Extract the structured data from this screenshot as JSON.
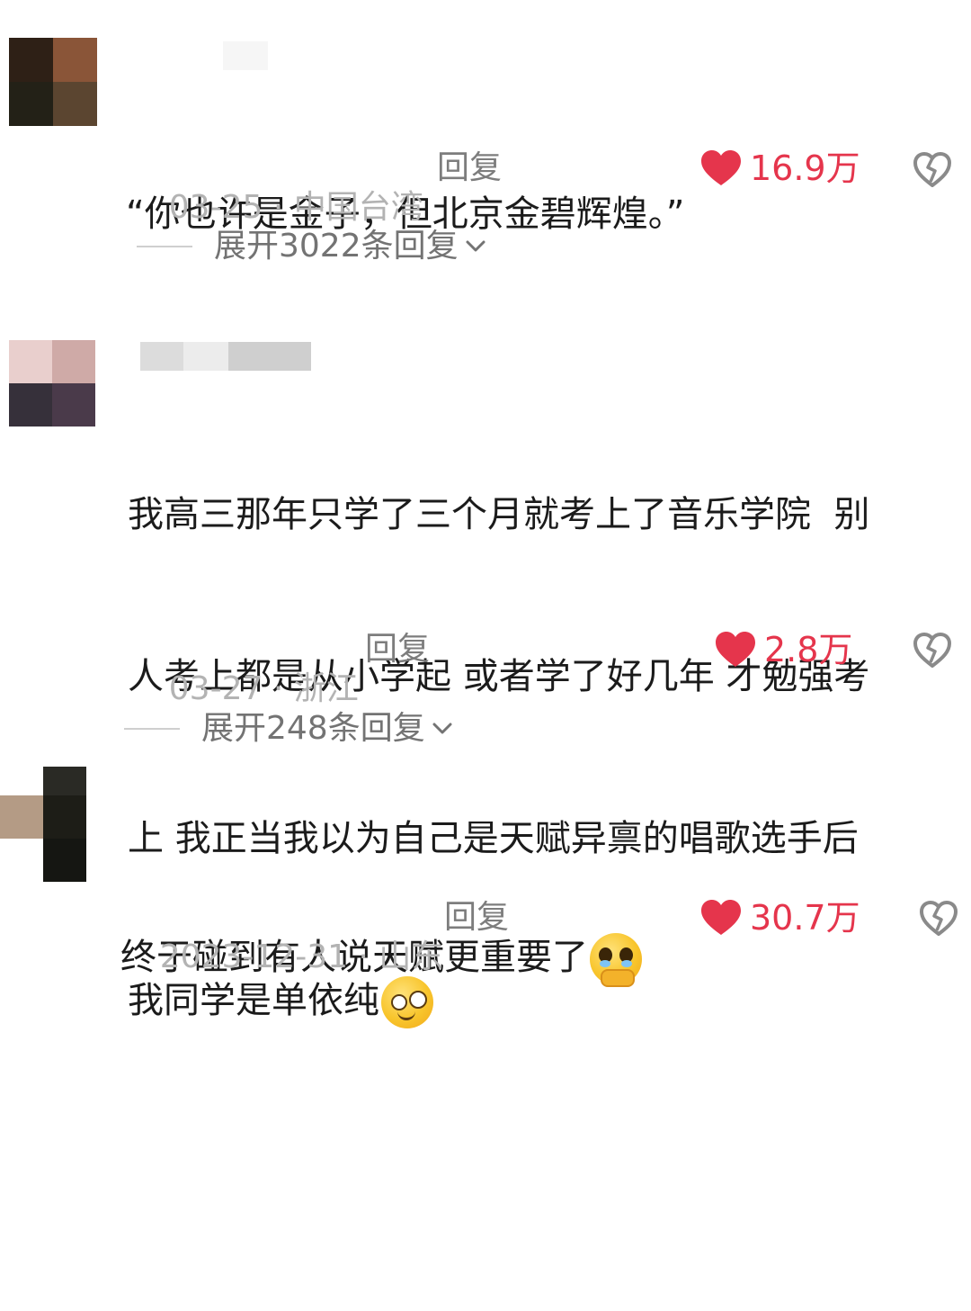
{
  "comments": [
    {
      "avatar_colors": [
        "#2e2016",
        "#8a5538",
        "#232117",
        "#5b4530"
      ],
      "username_colors": [
        "#fafafa",
        "#f3f3f3"
      ],
      "text_lines": [
        "“你也许是金子，但北京金碧辉煌。”"
      ],
      "date": "03-25",
      "location": "中国台湾",
      "reply_label": "回复",
      "likes": "16.9万",
      "expand_label": "展开3022条回复"
    },
    {
      "avatar_colors": [
        "#e9cfcd",
        "#cfaaa7",
        "#36303a",
        "#4a3a4a"
      ],
      "username_colors": [
        "#dcdcdc",
        "#ececec",
        "#cfcfcf"
      ],
      "text_lines": [
        "我高三那年只学了三个月就考上了音乐学院  别",
        "人考上都是从小学起 或者学了好几年 才勉强考",
        "上 我正当我以为自己是天赋异禀的唱歌选手后",
        "我同学是单依纯"
      ],
      "emoji": "dazed-face-emoji",
      "date": "03-27",
      "location": "浙江",
      "reply_label": "回复",
      "likes": "2.8万",
      "expand_label": "展开248条回复"
    },
    {
      "avatar_colors": [
        "#b49b85",
        "#1d1d17",
        "#d8c7b6",
        "#151612"
      ],
      "text_lines": [
        "终于碰到有人说天赋更重要了"
      ],
      "emoji": "holding-back-tears-emoji",
      "date": "2023-12-31",
      "location": "山东",
      "reply_label": "回复",
      "likes": "30.7万"
    }
  ],
  "colors": {
    "like": "#e5354c",
    "meta": "#b3b3b3",
    "text": "#1b1b1b"
  },
  "icons": {
    "like": "heart-icon",
    "dislike": "broken-heart-icon",
    "expand": "chevron-down-icon"
  },
  "separator": " · "
}
